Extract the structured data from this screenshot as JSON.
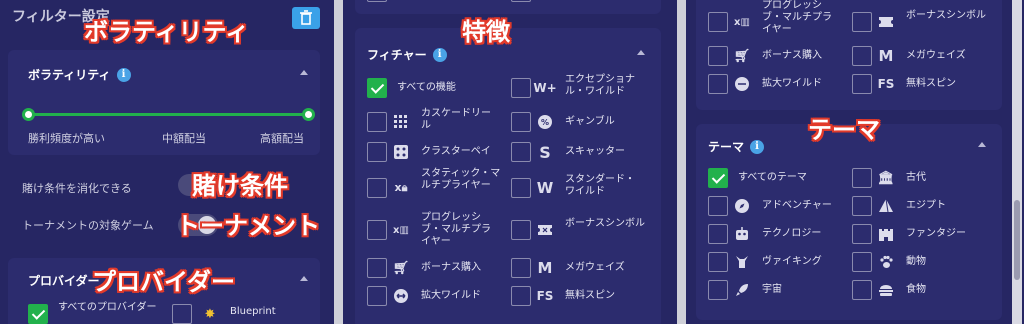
{
  "colors": {
    "panel_bg": "#262663",
    "card_bg": "#2c2c6e",
    "accent_green": "#22b14c",
    "info_blue": "#4aa3e6",
    "annotation_red": "#e23a2a"
  },
  "annotations": {
    "volatility": "ボラティリティ",
    "bet": "賭け条件",
    "tournament": "トーナメント",
    "provider": "プロバイダー",
    "features": "特徴",
    "theme": "テーマ"
  },
  "left": {
    "header_title": "フィルター設定",
    "trash_icon": "trash-icon",
    "volatility": {
      "title": "ボラティリティ",
      "info_icon": "i",
      "slider": {
        "min_selected": 0,
        "max_selected": 1
      },
      "labels": [
        "勝利頻度が高い",
        "中額配当",
        "高額配当"
      ]
    },
    "bet_requirement_label": "賭け条件を消化できる",
    "tournament_label": "トーナメントの対象ゲーム",
    "provider": {
      "title": "プロバイダー",
      "all_label": "すべてのプロバイダー",
      "blueprint_label": "Blueprint"
    }
  },
  "middle": {
    "feature": {
      "title": "フィチャー",
      "info_icon": "i",
      "items": [
        {
          "label": "すべての機能",
          "checked": true,
          "icon": ""
        },
        {
          "label": "エクセプショナル・ワイルド",
          "checked": false,
          "icon": "W+"
        },
        {
          "label": "カスケードリール",
          "checked": false,
          "icon": "grid-icon"
        },
        {
          "label": "ギャンブル",
          "checked": false,
          "icon": "gamble-icon"
        },
        {
          "label": "クラスターペイ",
          "checked": false,
          "icon": "cluster-icon"
        },
        {
          "label": "スキャッター",
          "checked": false,
          "icon": "S"
        },
        {
          "label": "スタティック・マルチプライヤー",
          "checked": false,
          "icon": "x-lock-icon"
        },
        {
          "label": "スタンダード・ワイルド",
          "checked": false,
          "icon": "W"
        },
        {
          "label": "プログレッシブ・マルチプライヤー",
          "checked": false,
          "icon": "x-bars-icon"
        },
        {
          "label": "ボーナスシンボル",
          "checked": false,
          "icon": "ticket-icon"
        },
        {
          "label": "ボーナス購入",
          "checked": false,
          "icon": "cart-icon"
        },
        {
          "label": "メガウェイズ",
          "checked": false,
          "icon": "M"
        },
        {
          "label": "拡大ワイルド",
          "checked": false,
          "icon": "expand-icon"
        },
        {
          "label": "無料スピン",
          "checked": false,
          "icon": "FS"
        }
      ]
    }
  },
  "right": {
    "feature_tail": [
      {
        "label": "プログレッシブ・マルチプライヤー",
        "icon": "x-bars-icon"
      },
      {
        "label": "ボーナスシンボル",
        "icon": "ticket-icon"
      },
      {
        "label": "ボーナス購入",
        "icon": "cart-icon"
      },
      {
        "label": "メガウェイズ",
        "icon": "M"
      },
      {
        "label": "拡大ワイルド",
        "icon": "expand-icon"
      },
      {
        "label": "無料スピン",
        "icon": "FS"
      }
    ],
    "theme": {
      "title": "テーマ",
      "info_icon": "i",
      "items": [
        {
          "label": "すべてのテーマ",
          "checked": true,
          "icon": ""
        },
        {
          "label": "古代",
          "checked": false,
          "icon": "temple-icon"
        },
        {
          "label": "アドベンチャー",
          "checked": false,
          "icon": "compass-icon"
        },
        {
          "label": "エジプト",
          "checked": false,
          "icon": "pyramid-icon"
        },
        {
          "label": "テクノロジー",
          "checked": false,
          "icon": "robot-icon"
        },
        {
          "label": "ファンタジー",
          "checked": false,
          "icon": "castle-icon"
        },
        {
          "label": "ヴァイキング",
          "checked": false,
          "icon": "viking-icon"
        },
        {
          "label": "動物",
          "checked": false,
          "icon": "paw-icon"
        },
        {
          "label": "宇宙",
          "checked": false,
          "icon": "rocket-icon"
        },
        {
          "label": "食物",
          "checked": false,
          "icon": "burger-icon"
        }
      ]
    }
  }
}
